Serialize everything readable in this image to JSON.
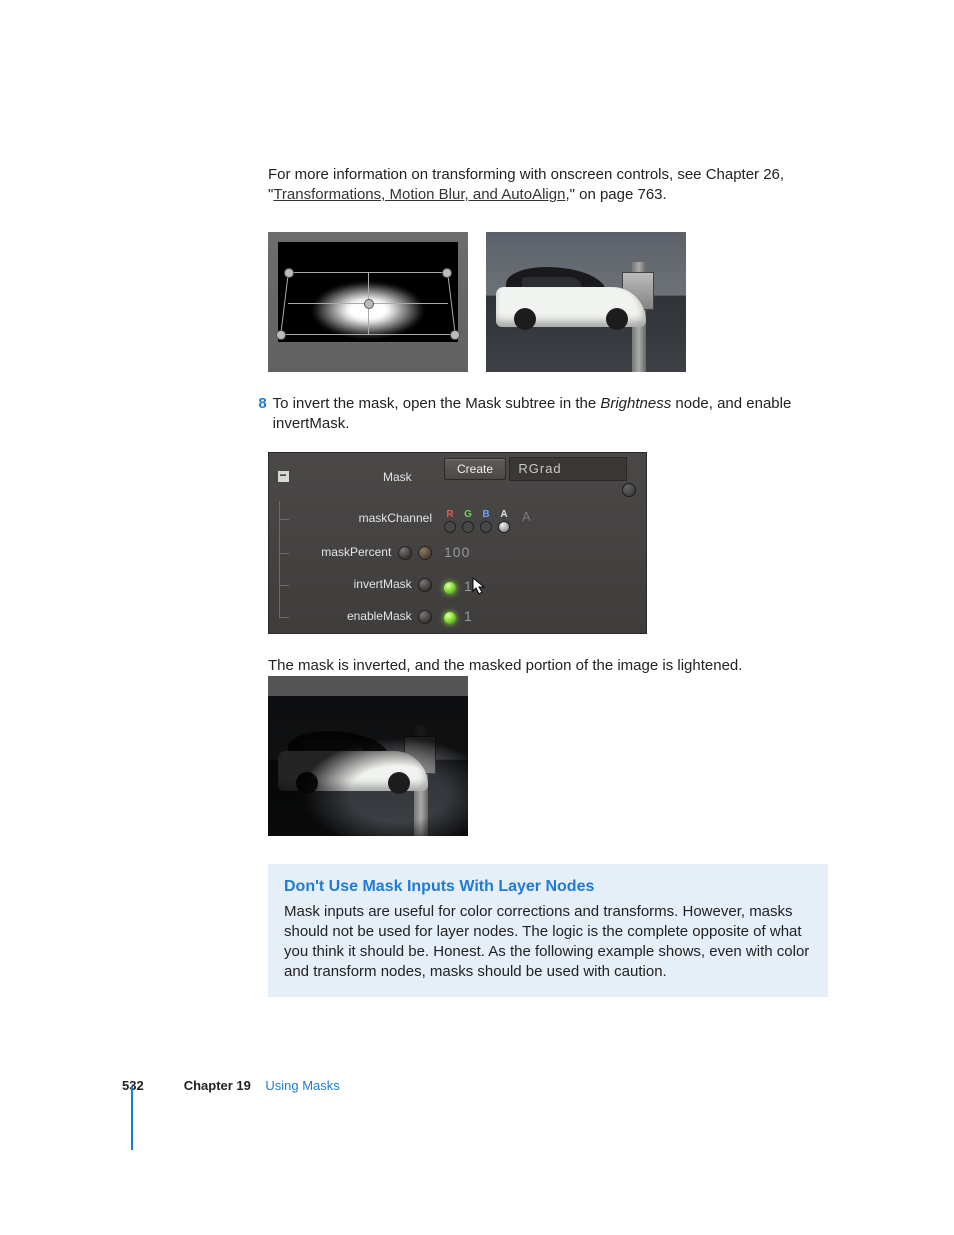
{
  "intro": {
    "line1": "For more information on transforming with onscreen controls, see Chapter 26,",
    "link": "Transformations, Motion Blur, and AutoAlign",
    "tail": ",\" on page 763.",
    "quote": "\""
  },
  "step": {
    "num": "8",
    "text1": "To invert the mask, open the Mask subtree in the ",
    "textItalic": "Brightness",
    "text2": " node, and enable invertMask."
  },
  "panel": {
    "rows": {
      "mask": "Mask",
      "maskChannel": "maskChannel",
      "maskPercent": "maskPercent",
      "invertMask": "invertMask",
      "enableMask": "enableMask"
    },
    "create": "Create",
    "nodeName": "RGrad",
    "channels": {
      "r": "R",
      "g": "G",
      "b": "B",
      "a": "A",
      "alpha2": "A"
    },
    "percentVal": "100",
    "invertVal": "1",
    "enableVal": "1"
  },
  "afterPanel": "The mask is inverted, and the masked portion of the image is lightened.",
  "note": {
    "title": "Don't Use Mask Inputs With Layer Nodes",
    "body": "Mask inputs are useful for color corrections and transforms. However, masks should not be used for layer nodes. The logic is the complete opposite of what you think it should be. Honest. As the following example shows, even with color and transform nodes, masks should be used with caution."
  },
  "footer": {
    "page": "532",
    "chapter": "Chapter 19",
    "title": "Using Masks"
  }
}
